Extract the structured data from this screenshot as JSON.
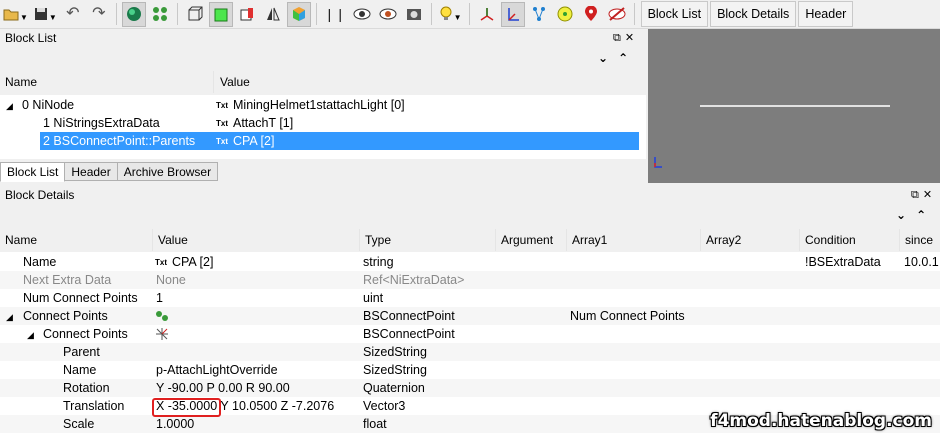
{
  "toolbar": {
    "icons": [
      "open-icon",
      "save-icon",
      "undo-icon",
      "redo-icon",
      "globe-icon",
      "nodes-icon",
      "cube-outline-icon",
      "cube-green-icon",
      "cube-red-icon",
      "mirror-icon",
      "cube-color-icon",
      "footprint-icon",
      "eye-icon",
      "eye-brush-icon",
      "screenshot-icon",
      "bulb-icon",
      "axes-red-icon",
      "axes-blue-icon",
      "branch-icon",
      "sphere-icon",
      "marker-icon",
      "hide-eye-icon"
    ],
    "block_list_btn": "Block List",
    "block_details_btn": "Block Details",
    "header_btn": "Header"
  },
  "block_list": {
    "title": "Block List",
    "columns": [
      "Name",
      "Value"
    ],
    "rows": [
      {
        "name": "0 NiNode",
        "value": "MiningHelmet1stattachLight [0]",
        "icon": "Txt"
      },
      {
        "name": "1 NiStringsExtraData",
        "value": "AttachT [1]",
        "icon": "Txt"
      },
      {
        "name": "2 BSConnectPoint::Parents",
        "value": "CPA [2]",
        "icon": "Txt"
      }
    ],
    "tabs": [
      "Block List",
      "Header",
      "Archive Browser"
    ]
  },
  "block_details": {
    "title": "Block Details",
    "columns": [
      "Name",
      "Value",
      "Type",
      "Argument",
      "Array1",
      "Array2",
      "Condition",
      "since"
    ],
    "rows": [
      {
        "name": "Name",
        "value": "CPA [2]",
        "icon": "Txt",
        "type": "string",
        "arg": "",
        "arr1": "",
        "cond": "!BSExtraData",
        "since": "10.0.1"
      },
      {
        "name": "Next Extra Data",
        "value": "None",
        "type": "Ref<NiExtraData>",
        "arr1": "",
        "cond": "",
        "since": ""
      },
      {
        "name": "Num Connect Points",
        "value": "1",
        "type": "uint",
        "arr1": "",
        "cond": "",
        "since": ""
      },
      {
        "name": "Connect Points",
        "value": "",
        "type": "BSConnectPoint",
        "arr1": "Num Connect Points",
        "cond": "",
        "since": ""
      },
      {
        "name": "Connect Points",
        "value": "",
        "type": "BSConnectPoint",
        "arr1": "",
        "cond": "",
        "since": ""
      },
      {
        "name": "Parent",
        "value": "",
        "type": "SizedString",
        "arr1": "",
        "cond": "",
        "since": ""
      },
      {
        "name": "Name",
        "value": "p-AttachLightOverride",
        "type": "SizedString",
        "arr1": "",
        "cond": "",
        "since": ""
      },
      {
        "name": "Rotation",
        "value": "Y -90.00 P 0.00 R 90.00",
        "type": "Quaternion",
        "arr1": "",
        "cond": "",
        "since": ""
      },
      {
        "name": "Translation",
        "value": "X -35.0000 Y 10.0500 Z -7.2076",
        "type": "Vector3",
        "arr1": "",
        "cond": "",
        "since": ""
      },
      {
        "name": "Scale",
        "value": "1.0000",
        "type": "float",
        "arr1": "",
        "cond": "",
        "since": ""
      }
    ]
  },
  "watermark": "f4mod.hatenablog.com",
  "colors": {
    "selection": "#3399ff",
    "highlight": "#e02020",
    "viewport": "#7d7d7d"
  }
}
